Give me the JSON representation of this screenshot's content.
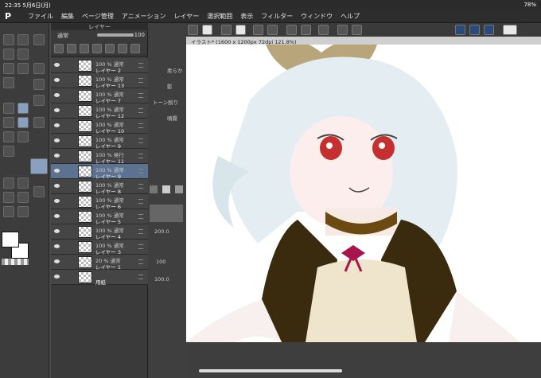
{
  "status": {
    "time": "22:35",
    "date": "5月6日(月)",
    "battery": "78%"
  },
  "menu": [
    "ファイル",
    "編集",
    "ページ管理",
    "アニメーション",
    "レイヤー",
    "選択範囲",
    "表示",
    "フィルター",
    "ウィンドウ",
    "ヘルプ"
  ],
  "canvas": {
    "tab_title": "イラスト* (1600 x 1200px 72dpi 121.8%)"
  },
  "layer_panel": {
    "title": "レイヤー",
    "blend_mode": "通常",
    "opacity": "100",
    "layers": [
      {
        "opacity": "100 % 通常",
        "name": "レイヤー 2"
      },
      {
        "opacity": "100 % 通常",
        "name": "レイヤー 13"
      },
      {
        "opacity": "100 % 通常",
        "name": "レイヤー 7"
      },
      {
        "opacity": "100 % 通常",
        "name": "レイヤー 12"
      },
      {
        "opacity": "100 % 通常",
        "name": "レイヤー 10"
      },
      {
        "opacity": "100 % 通常",
        "name": "レイヤー 9"
      },
      {
        "opacity": "100 % 発行",
        "name": "レイヤー 11"
      },
      {
        "opacity": "100 % 通常",
        "name": "レイヤー 9"
      },
      {
        "opacity": "100 % 通常",
        "name": "レイヤー 8"
      },
      {
        "opacity": "100 % 通常",
        "name": "レイヤー 6"
      },
      {
        "opacity": "100 % 通常",
        "name": "レイヤー 5"
      },
      {
        "opacity": "100 % 通常",
        "name": "レイヤー 4"
      },
      {
        "opacity": "100 % 通常",
        "name": "レイヤー 3"
      },
      {
        "opacity": "20 % 通常",
        "name": "レイヤー 1"
      },
      {
        "opacity": "",
        "name": "用紙"
      }
    ]
  },
  "sub_panel": {
    "labels": [
      "柔らか",
      "影",
      "トーン削り",
      "噴霧"
    ],
    "values": [
      "200.0",
      "100",
      "100.0"
    ]
  },
  "colors": {
    "accent": "#5d7290",
    "panel": "#3a3a3a"
  }
}
